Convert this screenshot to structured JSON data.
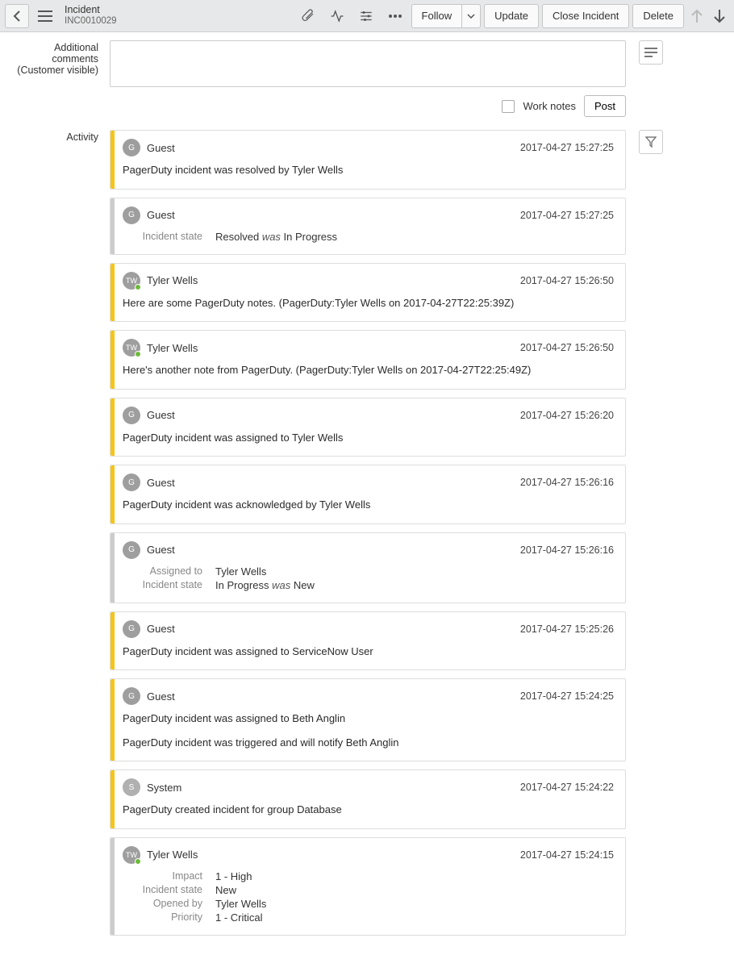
{
  "header": {
    "title": "Incident",
    "number": "INC0010029",
    "actions": {
      "follow": "Follow",
      "update": "Update",
      "close": "Close Incident",
      "delete": "Delete"
    }
  },
  "form": {
    "comments_label_l1": "Additional comments",
    "comments_label_l2": "(Customer visible)",
    "worknotes_label": "Work notes",
    "post_label": "Post",
    "activity_label": "Activity"
  },
  "avatars": {
    "guest_initial": "G",
    "system_initial": "S",
    "tw_initial": "TW"
  },
  "field_labels": {
    "incident_state": "Incident state",
    "assigned_to": "Assigned to",
    "impact": "Impact",
    "opened_by": "Opened by",
    "priority": "Priority"
  },
  "was_label": "was",
  "entries": [
    {
      "stripe": "yellow",
      "avatar": "guest",
      "author": "Guest",
      "ts": "2017-04-27 15:27:25",
      "lines": [
        "PagerDuty incident was resolved by Tyler Wells"
      ]
    },
    {
      "stripe": "gray",
      "avatar": "guest",
      "author": "Guest",
      "ts": "2017-04-27 15:27:25",
      "fields": [
        {
          "label": "incident_state",
          "value": "Resolved",
          "was": "In Progress"
        }
      ]
    },
    {
      "stripe": "yellow",
      "avatar": "tw",
      "presence": true,
      "author": "Tyler Wells",
      "ts": "2017-04-27 15:26:50",
      "lines": [
        "Here are some PagerDuty notes. (PagerDuty:Tyler Wells on 2017-04-27T22:25:39Z)"
      ]
    },
    {
      "stripe": "yellow",
      "avatar": "tw",
      "presence": true,
      "author": "Tyler Wells",
      "ts": "2017-04-27 15:26:50",
      "lines": [
        "Here's another note from PagerDuty. (PagerDuty:Tyler Wells on 2017-04-27T22:25:49Z)"
      ]
    },
    {
      "stripe": "yellow",
      "avatar": "guest",
      "author": "Guest",
      "ts": "2017-04-27 15:26:20",
      "lines": [
        "PagerDuty incident was assigned to Tyler Wells"
      ]
    },
    {
      "stripe": "yellow",
      "avatar": "guest",
      "author": "Guest",
      "ts": "2017-04-27 15:26:16",
      "lines": [
        "PagerDuty incident was acknowledged by Tyler Wells"
      ]
    },
    {
      "stripe": "gray",
      "avatar": "guest",
      "author": "Guest",
      "ts": "2017-04-27 15:26:16",
      "fields": [
        {
          "label": "assigned_to",
          "value": "Tyler Wells"
        },
        {
          "label": "incident_state",
          "value": "In Progress",
          "was": "New"
        }
      ]
    },
    {
      "stripe": "yellow",
      "avatar": "guest",
      "author": "Guest",
      "ts": "2017-04-27 15:25:26",
      "lines": [
        "PagerDuty incident was assigned to ServiceNow User"
      ]
    },
    {
      "stripe": "yellow",
      "avatar": "guest",
      "author": "Guest",
      "ts": "2017-04-27 15:24:25",
      "lines": [
        "PagerDuty incident was assigned to Beth Anglin",
        "PagerDuty incident was triggered and will notify Beth Anglin"
      ]
    },
    {
      "stripe": "yellow",
      "avatar": "system",
      "author": "System",
      "ts": "2017-04-27 15:24:22",
      "lines": [
        "PagerDuty created incident for group Database"
      ]
    },
    {
      "stripe": "gray",
      "avatar": "tw",
      "presence": true,
      "author": "Tyler Wells",
      "ts": "2017-04-27 15:24:15",
      "fields": [
        {
          "label": "impact",
          "value": "1 - High"
        },
        {
          "label": "incident_state",
          "value": "New"
        },
        {
          "label": "opened_by",
          "value": "Tyler Wells"
        },
        {
          "label": "priority",
          "value": "1 - Critical"
        }
      ]
    }
  ]
}
